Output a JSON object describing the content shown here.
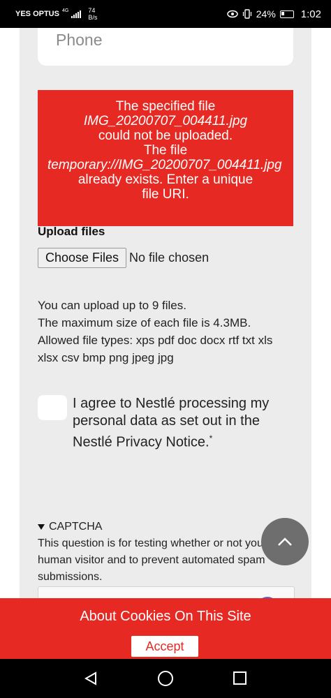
{
  "status_bar": {
    "carrier": "YES OPTUS",
    "network": "4G",
    "speed_value": "74",
    "speed_unit": "B/s",
    "battery": "24%",
    "time": "1:02"
  },
  "form": {
    "phone_placeholder": "Phone",
    "error": {
      "line1": "The specified file",
      "line2": "IMG_20200707_004411.jpg",
      "line3": "could not be uploaded.",
      "line4": "The file",
      "line5": "temporary://IMG_20200707_004411.jpg",
      "line6": "already exists. Enter a unique",
      "line7": "file URI."
    },
    "upload_label": "Upload files",
    "choose_files": "Choose Files",
    "no_file": "No file chosen",
    "help_line1": "You can upload up to 9 files.",
    "help_line2": "The maximum size of each file is 4.3MB.",
    "help_line3": "Allowed file types: xps pdf doc docx rtf txt xls xlsx csv bmp png jpeg jpg",
    "agree_text": "I agree to Nestlé processing my personal data as set out in the Nestlé Privacy Notice.",
    "agree_required": "*",
    "captcha_title": "CAPTCHA",
    "captcha_desc": "This question is for testing whether or not you are a human visitor and to prevent automated spam submissions."
  },
  "cookie_banner": {
    "title": "About Cookies On This Site",
    "accept": "Accept"
  },
  "colors": {
    "brand_red": "#e62a23",
    "page_bg": "#ececec"
  }
}
